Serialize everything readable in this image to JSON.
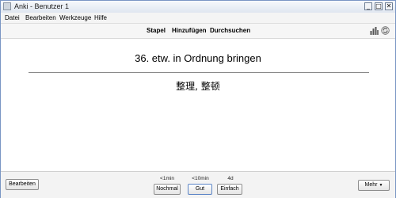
{
  "window": {
    "title": "Anki - Benutzer 1",
    "controls": {
      "minimize": "_",
      "maximize": "□",
      "close": "✕"
    }
  },
  "menubar": {
    "items": [
      "Datei",
      "Bearbeiten",
      "Werkzeuge",
      "Hilfe"
    ]
  },
  "toolbar": {
    "links": [
      "Stapel",
      "Hinzufügen",
      "Durchsuchen"
    ],
    "icons": [
      "stats-icon",
      "sync-icon"
    ]
  },
  "card": {
    "question": "36. etw. in Ordnung bringen",
    "answer": "整理, 整顿"
  },
  "bottombar": {
    "edit_label": "Bearbeiten",
    "answer_buttons": [
      {
        "interval": "<1min",
        "label": "Nochmal"
      },
      {
        "interval": "<10min",
        "label": "Gut"
      },
      {
        "interval": "4d",
        "label": "Einfach"
      }
    ],
    "more_label": "Mehr"
  },
  "colors": {
    "window_border": "#7a96c4",
    "default_button_border": "#5d86c7"
  }
}
